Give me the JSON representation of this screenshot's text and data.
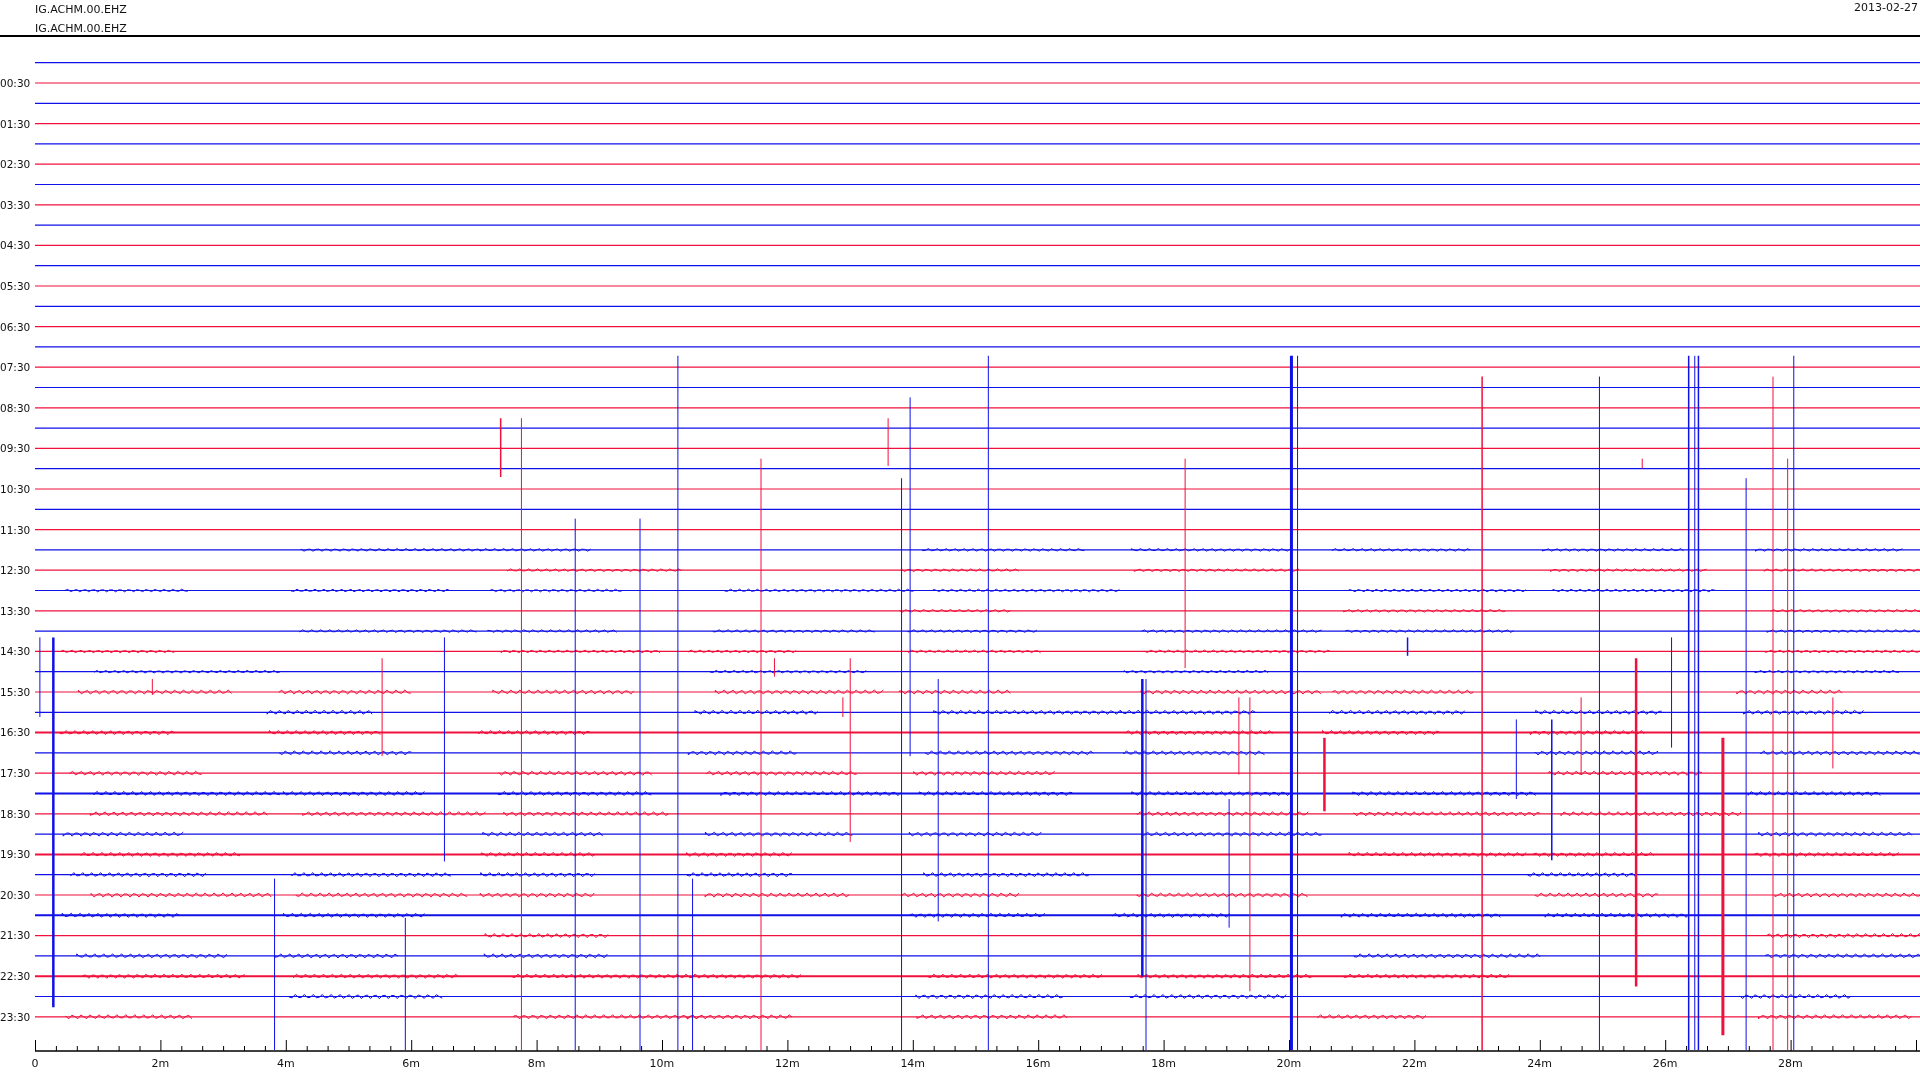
{
  "header": {
    "titles": [
      "IG.ACHM.00.EHZ",
      "IG.ACHM.00.EHZ"
    ],
    "date": "2013-02-27"
  },
  "plot": {
    "time_labels": [
      "00:30",
      "01:30",
      "02:30",
      "03:30",
      "04:30",
      "05:30",
      "06:30",
      "07:30",
      "08:30",
      "09:30",
      "10:30",
      "11:30",
      "12:30",
      "13:30",
      "14:30",
      "15:30",
      "16:30",
      "17:30",
      "18:30",
      "19:30",
      "20:30",
      "21:30",
      "22:30",
      "23:30"
    ],
    "x_axis_labels": [
      "0",
      "2m",
      "4m",
      "6m",
      "8m",
      "10m",
      "12m",
      "14m",
      "16m",
      "18m",
      "20m",
      "22m",
      "24m",
      "26m",
      "28m"
    ]
  }
}
